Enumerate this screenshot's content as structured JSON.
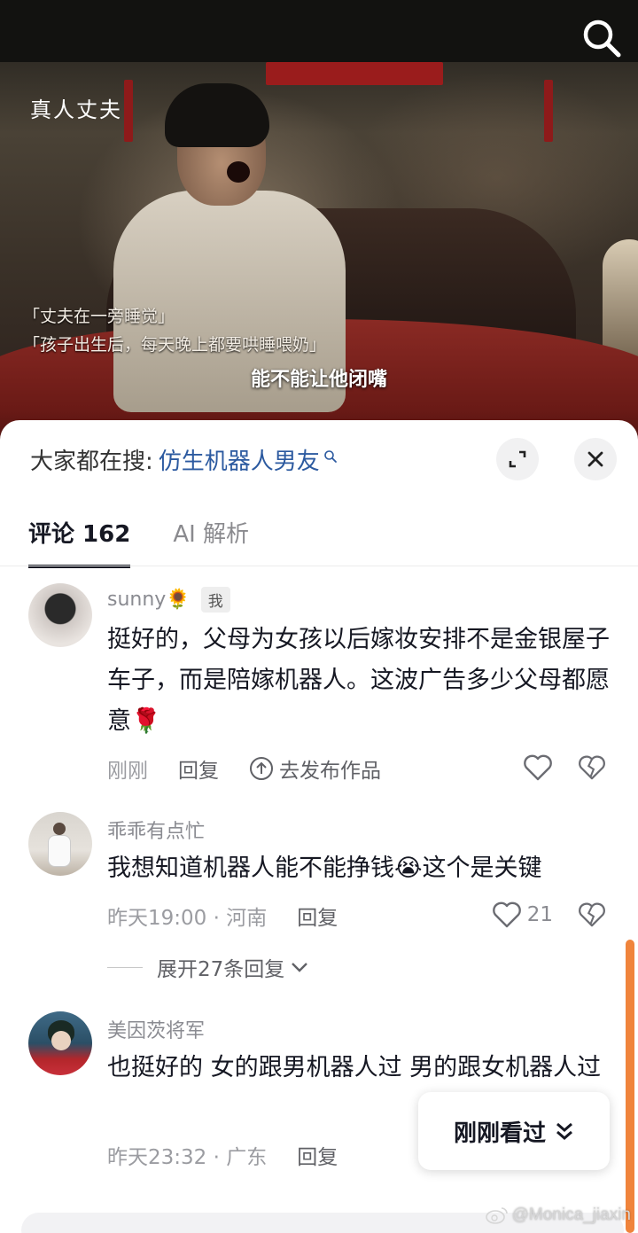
{
  "video": {
    "tag": "真人丈夫",
    "subtitles": [
      "「丈夫在一旁睡觉」",
      "「孩子出生后，每天晚上都要哄睡喂奶」"
    ],
    "caption": "能不能让他闭嘴"
  },
  "sheet": {
    "search_prefix": "大家都在搜:",
    "search_term": "仿生机器人男友",
    "tabs": [
      {
        "label": "评论 162",
        "active": true
      },
      {
        "label": "AI 解析",
        "active": false
      }
    ]
  },
  "comments": [
    {
      "user": "sunny🌻",
      "badge": "我",
      "text": "挺好的，父母为女孩以后嫁妆安排不是金银屋子车子，而是陪嫁机器人。这波广告多少父母都愿意🌹",
      "time": "刚刚",
      "reply": "回复",
      "publish": "去发布作品"
    },
    {
      "user": "乖乖有点忙",
      "text": "我想知道机器人能不能挣钱😭这个是关键",
      "time": "昨天19:00 · 河南",
      "reply": "回复",
      "likes": "21",
      "expand": "展开27条回复"
    },
    {
      "user": "美因茨将军",
      "text": "也挺好的 女的跟男机器人过 男的跟女机器人过",
      "time": "昨天23:32 · 广东",
      "reply": "回复"
    }
  ],
  "recent_button": "刚刚看过",
  "watermark": "@Monica_jiaxin",
  "colors": {
    "accent_link": "#2c5aa0",
    "scroll_indicator": "#f0843c"
  }
}
